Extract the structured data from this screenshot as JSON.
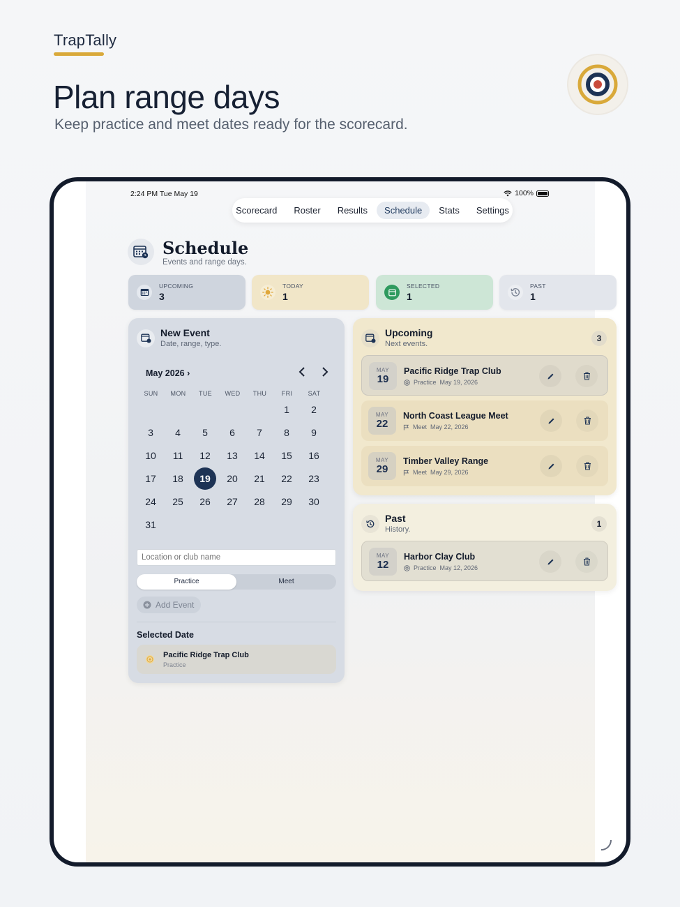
{
  "hero": {
    "brand": "TrapTally",
    "title": "Plan range days",
    "subtitle": "Keep practice and meet dates ready for the scorecard."
  },
  "status_bar": {
    "time": "2:24 PM   Tue May 19",
    "battery": "100%"
  },
  "tabs": [
    {
      "label": "Scorecard"
    },
    {
      "label": "Roster"
    },
    {
      "label": "Results"
    },
    {
      "label": "Schedule",
      "active": true
    },
    {
      "label": "Stats"
    },
    {
      "label": "Settings"
    }
  ],
  "page": {
    "title": "Schedule",
    "subtitle": "Events and range days."
  },
  "stats": [
    {
      "label": "UPCOMING",
      "value": "3",
      "icon": "calendar-icon",
      "bg": "#cfd5de"
    },
    {
      "label": "TODAY",
      "value": "1",
      "icon": "sun-icon",
      "bg": "#f1e6c8"
    },
    {
      "label": "SELECTED",
      "value": "1",
      "icon": "calendar-check-icon",
      "bg": "#cde6d6"
    },
    {
      "label": "PAST",
      "value": "1",
      "icon": "history-icon",
      "bg": "#e3e6ec"
    }
  ],
  "new_event": {
    "title": "New Event",
    "subtitle": "Date, range, type.",
    "month_label": "May 2026",
    "weekdays": [
      "SUN",
      "MON",
      "TUE",
      "WED",
      "THU",
      "FRI",
      "SAT"
    ],
    "first_weekday_index": 5,
    "days_in_month": 31,
    "selected_day": 19,
    "location_placeholder": "Location or club name",
    "type_options": [
      "Practice",
      "Meet"
    ],
    "type_selected": "Practice",
    "add_label": "Add Event",
    "selected_date_heading": "Selected Date",
    "selected_event": {
      "name": "Pacific Ridge Trap Club",
      "type": "Practice"
    }
  },
  "upcoming": {
    "title": "Upcoming",
    "subtitle": "Next events.",
    "count": "3",
    "events": [
      {
        "month": "MAY",
        "day": "19",
        "name": "Pacific Ridge Trap Club",
        "type": "Practice",
        "date": "May 19, 2026",
        "icon": "target-icon"
      },
      {
        "month": "MAY",
        "day": "22",
        "name": "North Coast League Meet",
        "type": "Meet",
        "date": "May 22, 2026",
        "icon": "flag-icon"
      },
      {
        "month": "MAY",
        "day": "29",
        "name": "Timber Valley Range",
        "type": "Meet",
        "date": "May 29, 2026",
        "icon": "flag-icon"
      }
    ]
  },
  "past": {
    "title": "Past",
    "subtitle": "History.",
    "count": "1",
    "events": [
      {
        "month": "MAY",
        "day": "12",
        "name": "Harbor Clay Club",
        "type": "Practice",
        "date": "May 12, 2026",
        "icon": "target-icon"
      }
    ]
  },
  "colors": {
    "accent": "#1d3355",
    "gold": "#d9a93a",
    "target_red": "#c94a3b"
  }
}
